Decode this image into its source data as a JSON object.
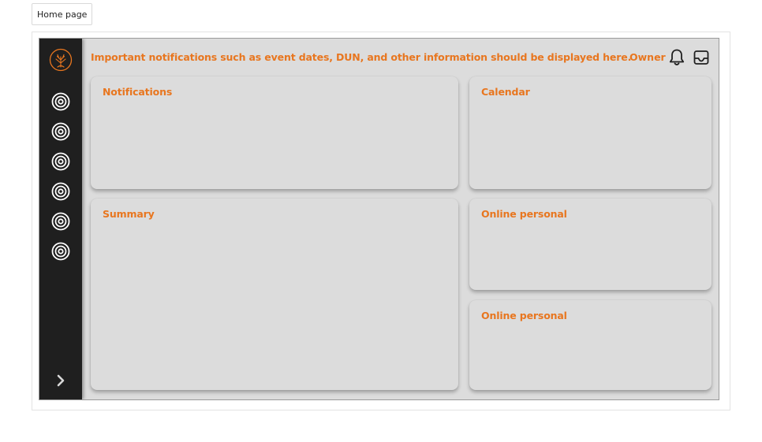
{
  "page_tab": {
    "label": "Home page"
  },
  "header": {
    "notice": "Important notifications such as event dates, DUN, and other information should be displayed here.",
    "user_label": "Owner",
    "icons": [
      "bell-icon",
      "inbox-icon"
    ]
  },
  "sidebar": {
    "logo": "tree-logo",
    "items": [
      {
        "icon": "target-icon"
      },
      {
        "icon": "target-icon"
      },
      {
        "icon": "target-icon"
      },
      {
        "icon": "target-icon"
      },
      {
        "icon": "target-icon"
      },
      {
        "icon": "target-icon"
      }
    ],
    "expand_icon": "chevron-right-icon"
  },
  "cards": {
    "notifications": {
      "title": "Notifications"
    },
    "calendar": {
      "title": "Calendar"
    },
    "summary": {
      "title": "Summary"
    },
    "online_personal_1": {
      "title": "Online personal"
    },
    "online_personal_2": {
      "title": "Online personal"
    }
  },
  "colors": {
    "accent": "#e8761f",
    "sidebar_bg": "#1f1f1f",
    "surface": "#dcdcdc"
  }
}
